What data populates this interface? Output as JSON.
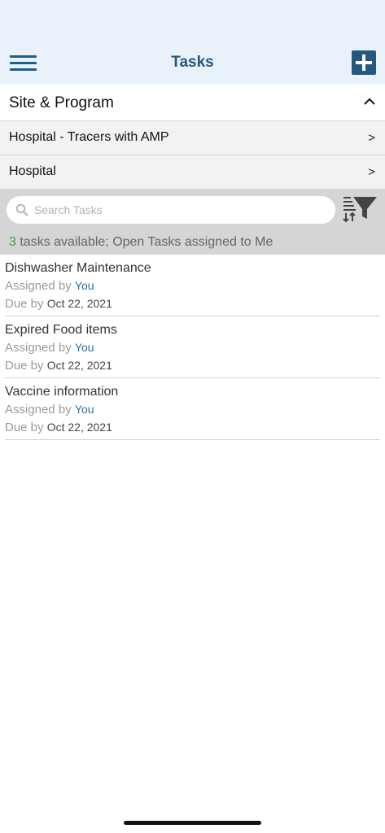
{
  "header": {
    "title": "Tasks",
    "menu_icon": "hamburger-icon",
    "add_icon": "plus-icon",
    "accent": "#24587d"
  },
  "site_program": {
    "label": "Site & Program",
    "expand_icon": "chevron-up-icon"
  },
  "nav_rows": [
    {
      "label": "Hospital - Tracers with AMP",
      "arrow": ">"
    },
    {
      "label": "Hospital",
      "arrow": ">"
    }
  ],
  "search": {
    "placeholder": "Search Tasks",
    "value": "",
    "filter_icon": "sort-filter-icon"
  },
  "summary": {
    "count": "3",
    "text": " tasks available; Open Tasks assigned to Me"
  },
  "tasks": [
    {
      "name": "Dishwasher Maintenance",
      "assigned_prefix": "Assigned by ",
      "assigned_by": "You",
      "due_prefix": "Due by ",
      "due": "Oct 22, 2021"
    },
    {
      "name": "Expired Food items",
      "assigned_prefix": "Assigned by ",
      "assigned_by": "You",
      "due_prefix": "Due by ",
      "due": "Oct 22, 2021"
    },
    {
      "name": "Vaccine information",
      "assigned_prefix": "Assigned by ",
      "assigned_by": "You",
      "due_prefix": "Due by ",
      "due": "Oct 22, 2021"
    }
  ]
}
